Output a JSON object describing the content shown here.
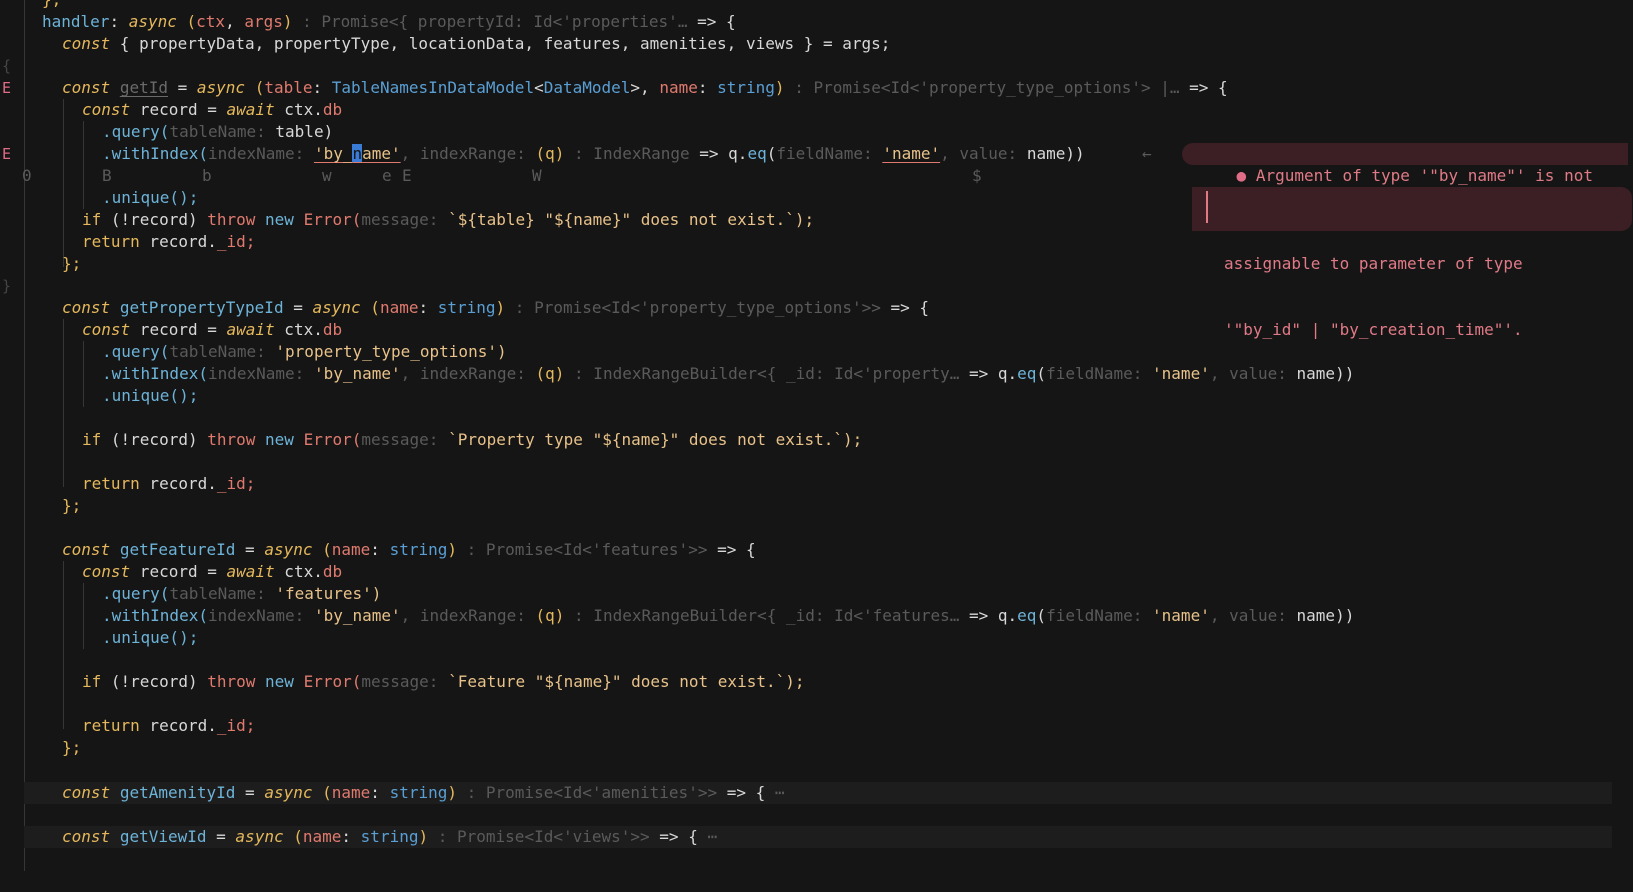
{
  "gutter": {
    "E": "E",
    "brace_open": "{",
    "brace_close": "}"
  },
  "lines": {
    "l0": "},",
    "l1_handler": "handler",
    "l1_colon": ": ",
    "l1_async": "async",
    "l1_ctx": "ctx",
    "l1_args": "args",
    "l1_hint": " : Promise<{ propertyId: Id<'properties'… ",
    "l1_arrow": "=> {",
    "l2_const": "const",
    "l2_body": " { propertyData, propertyType, locationData, features, amenities, views } = args;",
    "l4_const": "const",
    "l4_name": "getId",
    "l4_eq": " = ",
    "l4_async": "async",
    "l4_table": "table",
    "l4_tablety": "TableNamesInDataModel",
    "l4_dm": "DataModel",
    "l4_nameparam": "name",
    "l4_string": "string",
    "l4_hint": " : Promise<Id<'property_type_options'> |… ",
    "l4_arrow": "=> {",
    "l5_const": "const",
    "l5_rec": " record = ",
    "l5_await": "await",
    "l5_ctx": " ctx.",
    "l5_db": "db",
    "l6_query": ".query(",
    "l6_hint": "tableName: ",
    "l6_arg": "table)",
    "l7_wi": ".withIndex(",
    "l7_h1": "indexName: ",
    "l7_s1a": "'by_",
    "l7_s1cur": "n",
    "l7_s1b": "ame'",
    "l7_h2": ", indexRange: ",
    "l7_q": "(q)",
    "l7_h3": " : IndexRange ",
    "l7_arrow": "=> q.",
    "l7_eq": "eq",
    "l7_h4": "fieldName: ",
    "l7_s2": "'name'",
    "l7_h5": ", value: ",
    "l7_val": "name))",
    "l7_back": "←",
    "jump_hints": [
      "0",
      "B",
      "b",
      "w",
      "e",
      "E",
      "W",
      "$"
    ],
    "l9_unique": ".unique();",
    "l10_if": "if",
    "l10_rec": " (!record) ",
    "l10_throw": "throw",
    "l10_new": " new ",
    "l10_error": "Error(",
    "l10_hint": "message: ",
    "l10_msg": "`${table} \"${name}\" does not exist.`);",
    "l11_ret": "return",
    "l11_rec": " record.",
    "l11_id": "_id;",
    "l12": "};",
    "l14_const": "const",
    "l14_name": "getPropertyTypeId",
    "l14_eq": " = ",
    "l14_async": "async",
    "l14_param": "name",
    "l14_string": "string",
    "l14_hint": " : Promise<Id<'property_type_options'>> ",
    "l14_arrow": "=> {",
    "l16_query_arg": "'property_type_options')",
    "l17_h3": " : IndexRangeBuilder<{ _id: Id<'property… ",
    "l17_s1": "'by_name'",
    "l20_msg": "`Property type \"${name}\" does not exist.`);",
    "l25_name": "getFeatureId",
    "l25_hint": " : Promise<Id<'features'>> ",
    "l27_query_arg": "'features')",
    "l28_h3": " : IndexRangeBuilder<{ _id: Id<'features… ",
    "l31_msg": "`Feature \"${name}\" does not exist.`);",
    "l36_name": "getAmenityId",
    "l36_hint": " : Promise<Id<'amenities'>> ",
    "l38_name": "getViewId",
    "l38_hint": " : Promise<Id<'views'>> ",
    "fold_ellipsis": "⋯"
  },
  "diagnostic": {
    "line1": "Argument of type '\"by_name\"' is not",
    "line2": "assignable to parameter of type",
    "line3": "'\"by_id\" | \"by_creation_time\"'.",
    "dot": "●"
  },
  "colors": {
    "background": "#151515",
    "keyword": "#e5b85c",
    "function": "#6db3d8",
    "param": "#e07a6e",
    "type": "#5a9fd4",
    "string": "#e8c28a",
    "hint": "#5a5a5a",
    "error": "#e06c86",
    "error_bg": "#3b1f25"
  }
}
